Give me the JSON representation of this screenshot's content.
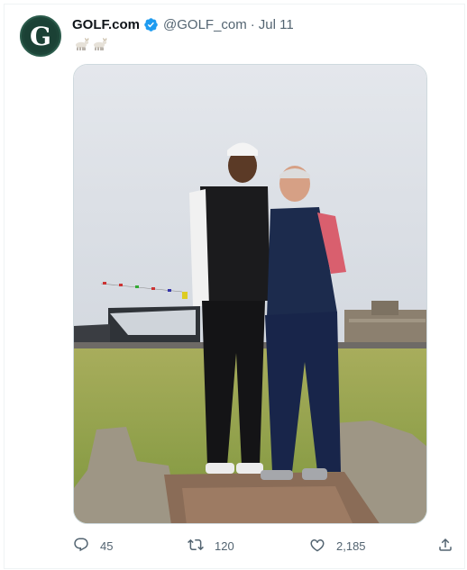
{
  "tweet": {
    "author": {
      "display_name": "GOLF.com",
      "handle": "@GOLF_com",
      "avatar_letter": "G",
      "verified": true
    },
    "separator": "·",
    "date": "Jul 11",
    "text_emojis": [
      "goat-emoji",
      "goat-emoji"
    ],
    "media_description_icon": "photo"
  },
  "actions": {
    "reply_count": "45",
    "retweet_count": "120",
    "like_count": "2,185"
  },
  "colors": {
    "text_primary": "#0f1419",
    "text_secondary": "#536471",
    "verified_blue": "#1d9bf0",
    "avatar_green": "#1d4538"
  }
}
